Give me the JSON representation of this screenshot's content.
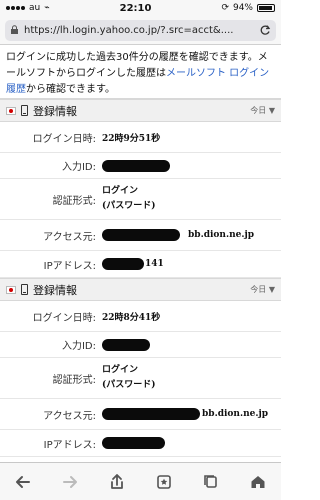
{
  "status_bar": {
    "carrier": "au",
    "time": "22:10",
    "battery": "94%",
    "battery_level": 0.94
  },
  "url": {
    "text": "https://lh.login.yahoo.co.jp/?.src=acct&...."
  },
  "intro": {
    "part1": "ログインに成功した過去30件分の履歴を確認できます。メールソフトからログインした履歴は",
    "link": "メールソフト ログイン履歴",
    "part2": "から確認できます。"
  },
  "sections": [
    {
      "title": "登録情報",
      "period": "今日",
      "rows": [
        {
          "label": "ログイン日時:",
          "value": "22時9分51秒"
        },
        {
          "label": "入力ID:",
          "value": "",
          "redacted": true
        },
        {
          "label": "認証形式:",
          "value": "ログイン\n(パスワード)"
        },
        {
          "label": "アクセス元:",
          "value": "bb.dion.ne.jp",
          "redacted": true
        },
        {
          "label": "IPアドレス:",
          "value": "141",
          "redacted": true
        }
      ]
    },
    {
      "title": "登録情報",
      "period": "今日",
      "rows": [
        {
          "label": "ログイン日時:",
          "value": "22時8分41秒"
        },
        {
          "label": "入力ID:",
          "value": "",
          "redacted": true
        },
        {
          "label": "認証形式:",
          "value": "ログイン\n(パスワード)"
        },
        {
          "label": "アクセス元:",
          "value": "bb.dion.ne.jp",
          "redacted": true
        },
        {
          "label": "IPアドレス:",
          "value": "",
          "redacted": true
        }
      ]
    }
  ],
  "toolbar": {
    "icons": [
      "back-arrow-icon",
      "forward-arrow-icon",
      "share-icon",
      "bookmark-icon",
      "tabs-icon",
      "home-icon"
    ]
  }
}
